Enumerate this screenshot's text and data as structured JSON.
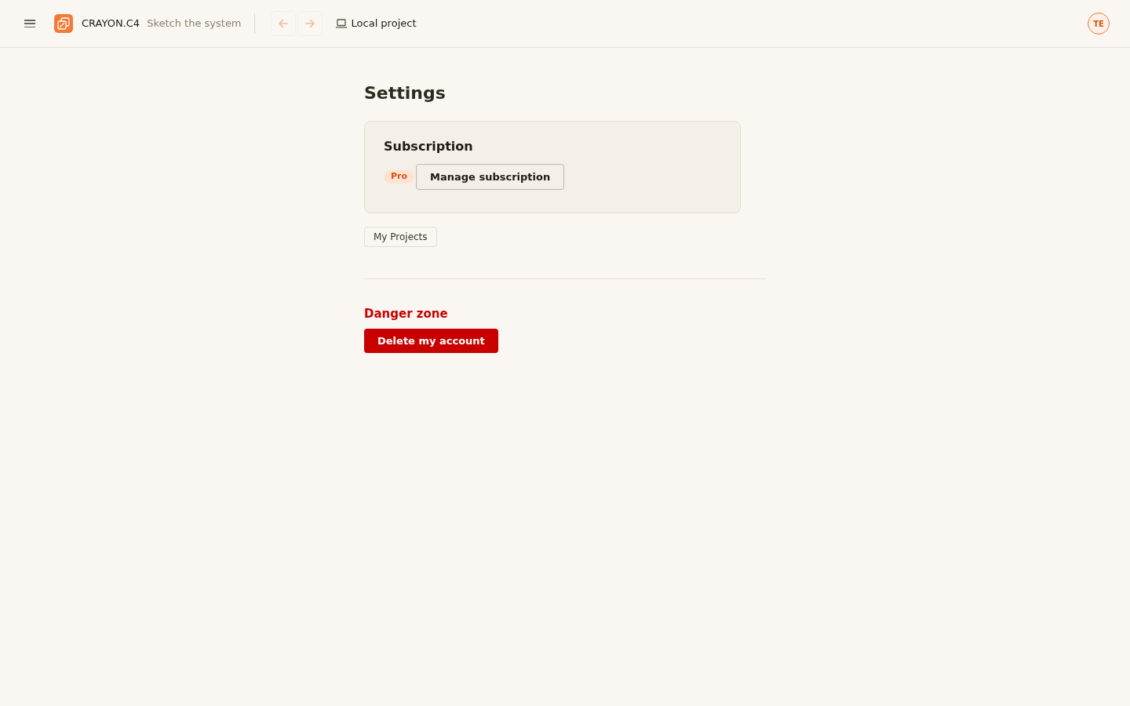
{
  "header": {
    "brand": {
      "name": "CRAYON.C4",
      "tagline": "Sketch the system"
    },
    "nav_buttons": [
      {
        "kind": "back",
        "disabled": true
      },
      {
        "kind": "forward",
        "disabled": true
      }
    ],
    "project": {
      "label": "Local project"
    },
    "avatar": {
      "initials": "TE"
    }
  },
  "page": {
    "title": "Settings",
    "subscription": {
      "title": "Subscription",
      "plan_badge": "Pro",
      "button": "Manage subscription"
    },
    "projects_button": "My Projects",
    "danger_zone": {
      "title": "Danger zone",
      "button": "Delete my account"
    }
  }
}
